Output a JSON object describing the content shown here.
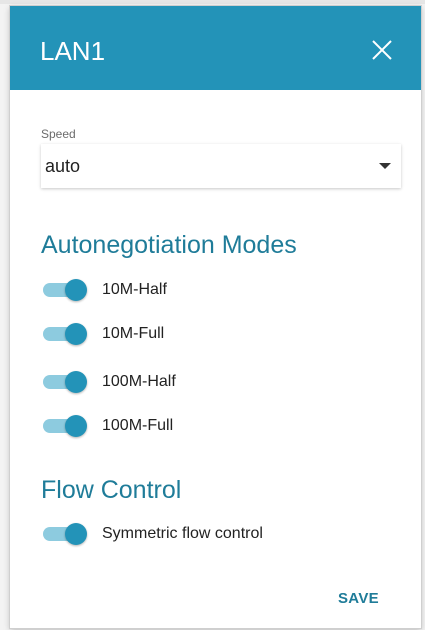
{
  "dialog": {
    "title": "LAN1",
    "close_icon": "close-icon",
    "accent_color": "#2393b8"
  },
  "speed": {
    "label": "Speed",
    "value": "auto",
    "arrow_icon": "caret-down-icon"
  },
  "autoneg": {
    "title": "Autonegotiation Modes",
    "modes": [
      {
        "label": "10M-Half",
        "enabled": true
      },
      {
        "label": "10M-Full",
        "enabled": true
      },
      {
        "label": "100M-Half",
        "enabled": true
      },
      {
        "label": "100M-Full",
        "enabled": true
      }
    ]
  },
  "flow": {
    "title": "Flow Control",
    "symmetric": {
      "label": "Symmetric flow control",
      "enabled": true
    }
  },
  "actions": {
    "save_label": "SAVE"
  }
}
